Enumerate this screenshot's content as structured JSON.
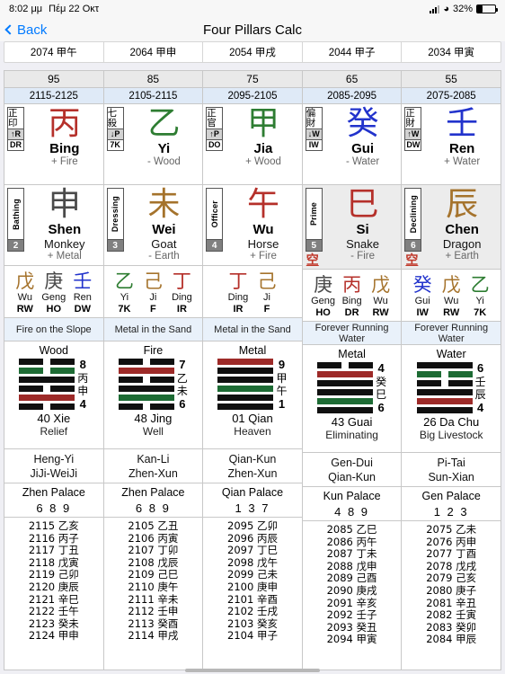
{
  "status_bar": {
    "time": "8:02 μμ",
    "date": "Πέμ 22 Οκτ",
    "battery_text": "32%",
    "battery_level": 32
  },
  "nav": {
    "back_label": "Back",
    "title": "Four Pillars Calc"
  },
  "year_strip": [
    {
      "label": "2074 甲午"
    },
    {
      "label": "2064 甲申"
    },
    {
      "label": "2054 甲戌"
    },
    {
      "label": "2044 甲子"
    },
    {
      "label": "2034 甲寅"
    }
  ],
  "colors": {
    "wood": "#2e7d32",
    "fire": "#b5302a",
    "earth": "#a5732c",
    "metal": "#4a4a4a",
    "water": "#2233cc",
    "accent": "#007aff",
    "hex_black": "#101010",
    "hex_red": "#9d2a28",
    "hex_green": "#1d6b34",
    "span_bg": "#dfeaf7",
    "nayin_bg": "#e9f1fa",
    "kong": "#c0392b"
  },
  "columns": [
    {
      "age": "95",
      "span": "2115-2125",
      "stem": {
        "god_zh": "正印",
        "god_arrow": "↑R",
        "god_abbr": "DR",
        "glyph": "丙",
        "pinyin": "Bing",
        "element": "+ Fire",
        "color": "#b5302a"
      },
      "branch": {
        "stage": "Bathing",
        "num": "2",
        "kong": "",
        "glyph": "申",
        "pinyin": "Shen",
        "animal": "Monkey",
        "element": "+ Metal",
        "color": "#4a4a4a"
      },
      "hidden": [
        {
          "glyph": "戊",
          "pinyin": "Wu",
          "abbr": "RW",
          "color": "#a5732c"
        },
        {
          "glyph": "庚",
          "pinyin": "Geng",
          "abbr": "HO",
          "color": "#4a4a4a"
        },
        {
          "glyph": "壬",
          "pinyin": "Ren",
          "abbr": "DW",
          "color": "#2233cc"
        }
      ],
      "nayin": "Fire on the Slope",
      "hexagram": {
        "element": "Wood",
        "lines": [
          "yin-black",
          "yang-red",
          "yin-black",
          "yang-black",
          "yin-green",
          "yin-black"
        ],
        "top_num": "8",
        "bottom_num": "4",
        "mid": [
          "丙",
          "申"
        ],
        "name": "40 Xie",
        "meaning": "Relief"
      },
      "pair": [
        "Heng-Yi",
        "JiJi-WeiJi"
      ],
      "palace": {
        "name": "Zhen Palace",
        "nums": "6 8 9"
      },
      "years": [
        "2115 乙亥",
        "2116 丙子",
        "2117 丁丑",
        "2118 戊寅",
        "2119 己卯",
        "2120 庚辰",
        "2121 辛巳",
        "2122 壬午",
        "2123 癸未",
        "2124 甲申"
      ]
    },
    {
      "age": "85",
      "span": "2105-2115",
      "stem": {
        "god_zh": "七殺",
        "god_arrow": "↓P",
        "god_abbr": "7K",
        "glyph": "乙",
        "pinyin": "Yi",
        "element": "- Wood",
        "color": "#2e7d32"
      },
      "branch": {
        "stage": "Dressing",
        "num": "3",
        "kong": "",
        "glyph": "未",
        "pinyin": "Wei",
        "animal": "Goat",
        "element": "- Earth",
        "color": "#a5732c"
      },
      "hidden": [
        {
          "glyph": "乙",
          "pinyin": "Yi",
          "abbr": "7K",
          "color": "#2e7d32"
        },
        {
          "glyph": "己",
          "pinyin": "Ji",
          "abbr": "F",
          "color": "#a5732c"
        },
        {
          "glyph": "丁",
          "pinyin": "Ding",
          "abbr": "IR",
          "color": "#b5302a"
        }
      ],
      "nayin": "Metal in the Sand",
      "hexagram": {
        "element": "Fire",
        "lines": [
          "yin-black",
          "yang-green",
          "yang-black",
          "yin-black",
          "yang-red",
          "yin-black"
        ],
        "top_num": "7",
        "bottom_num": "6",
        "mid": [
          "乙",
          "未"
        ],
        "name": "48 Jing",
        "meaning": "Well"
      },
      "pair": [
        "Kan-Li",
        "Zhen-Xun"
      ],
      "palace": {
        "name": "Zhen Palace",
        "nums": "6 8 9"
      },
      "years": [
        "2105 乙丑",
        "2106 丙寅",
        "2107 丁卯",
        "2108 戊辰",
        "2109 己巳",
        "2110 庚午",
        "2111 辛未",
        "2112 壬申",
        "2113 癸酉",
        "2114 甲戌"
      ]
    },
    {
      "age": "75",
      "span": "2095-2105",
      "stem": {
        "god_zh": "正官",
        "god_arrow": "↑P",
        "god_abbr": "DO",
        "glyph": "甲",
        "pinyin": "Jia",
        "element": "+ Wood",
        "color": "#2e7d32"
      },
      "branch": {
        "stage": "Officer",
        "num": "4",
        "kong": "",
        "glyph": "午",
        "pinyin": "Wu",
        "animal": "Horse",
        "element": "+ Fire",
        "color": "#b5302a"
      },
      "hidden": [
        {
          "glyph": "丁",
          "pinyin": "Ding",
          "abbr": "IR",
          "color": "#b5302a"
        },
        {
          "glyph": "己",
          "pinyin": "Ji",
          "abbr": "F",
          "color": "#a5732c"
        }
      ],
      "nayin": "Metal in the Sand",
      "hexagram": {
        "element": "Metal",
        "lines": [
          "yang-black",
          "yang-black",
          "yang-green",
          "yang-black",
          "yang-black",
          "yang-red"
        ],
        "top_num": "9",
        "bottom_num": "1",
        "mid": [
          "甲",
          "午"
        ],
        "name": "01 Qian",
        "meaning": "Heaven"
      },
      "pair": [
        "Qian-Kun",
        "Zhen-Xun"
      ],
      "palace": {
        "name": "Qian Palace",
        "nums": "1 3 7"
      },
      "years": [
        "2095 乙卯",
        "2096 丙辰",
        "2097 丁巳",
        "2098 戊午",
        "2099 己未",
        "2100 庚申",
        "2101 辛酉",
        "2102 壬戌",
        "2103 癸亥",
        "2104 甲子"
      ]
    },
    {
      "age": "65",
      "span": "2085-2095",
      "stem": {
        "god_zh": "偏財",
        "god_arrow": "↓W",
        "god_abbr": "IW",
        "glyph": "癸",
        "pinyin": "Gui",
        "element": "- Water",
        "color": "#2233cc"
      },
      "branch": {
        "stage": "Prime",
        "num": "5",
        "kong": "空",
        "glyph": "巳",
        "pinyin": "Si",
        "animal": "Snake",
        "element": "- Fire",
        "color": "#b5302a"
      },
      "hidden": [
        {
          "glyph": "庚",
          "pinyin": "Geng",
          "abbr": "HO",
          "color": "#4a4a4a"
        },
        {
          "glyph": "丙",
          "pinyin": "Bing",
          "abbr": "DR",
          "color": "#b5302a"
        },
        {
          "glyph": "戊",
          "pinyin": "Wu",
          "abbr": "RW",
          "color": "#a5732c"
        }
      ],
      "nayin": "Forever Running Water",
      "hexagram": {
        "element": "Metal",
        "lines": [
          "yang-black",
          "yang-green",
          "yang-black",
          "yang-black",
          "yang-red",
          "yin-black"
        ],
        "top_num": "4",
        "bottom_num": "6",
        "mid": [
          "癸",
          "巳"
        ],
        "name": "43 Guai",
        "meaning": "Eliminating"
      },
      "pair": [
        "Gen-Dui",
        "Qian-Kun"
      ],
      "palace": {
        "name": "Kun Palace",
        "nums": "4 8 9"
      },
      "years": [
        "2085 乙巳",
        "2086 丙午",
        "2087 丁未",
        "2088 戊申",
        "2089 己酉",
        "2090 庚戌",
        "2091 辛亥",
        "2092 壬子",
        "2093 癸丑",
        "2094 甲寅"
      ]
    },
    {
      "age": "55",
      "span": "2075-2085",
      "stem": {
        "god_zh": "正財",
        "god_arrow": "↑W",
        "god_abbr": "DW",
        "glyph": "壬",
        "pinyin": "Ren",
        "element": "+ Water",
        "color": "#2233cc"
      },
      "branch": {
        "stage": "Declining",
        "num": "6",
        "kong": "空",
        "glyph": "辰",
        "pinyin": "Chen",
        "animal": "Dragon",
        "element": "+ Earth",
        "color": "#a5732c"
      },
      "hidden": [
        {
          "glyph": "癸",
          "pinyin": "Gui",
          "abbr": "IW",
          "color": "#2233cc"
        },
        {
          "glyph": "戊",
          "pinyin": "Wu",
          "abbr": "RW",
          "color": "#a5732c"
        },
        {
          "glyph": "乙",
          "pinyin": "Yi",
          "abbr": "7K",
          "color": "#2e7d32"
        }
      ],
      "nayin": "Forever Running Water",
      "hexagram": {
        "element": "Water",
        "lines": [
          "yang-black",
          "yang-red",
          "yang-black",
          "yin-black",
          "yin-green",
          "yang-black"
        ],
        "top_num": "6",
        "bottom_num": "4",
        "mid": [
          "壬",
          "辰"
        ],
        "name": "26 Da Chu",
        "meaning": "Big Livestock"
      },
      "pair": [
        "Pi-Tai",
        "Sun-Xian"
      ],
      "palace": {
        "name": "Gen Palace",
        "nums": "1 2 3"
      },
      "years": [
        "2075 乙未",
        "2076 丙申",
        "2077 丁酉",
        "2078 戊戌",
        "2079 己亥",
        "2080 庚子",
        "2081 辛丑",
        "2082 壬寅",
        "2083 癸卯",
        "2084 甲辰"
      ]
    }
  ]
}
